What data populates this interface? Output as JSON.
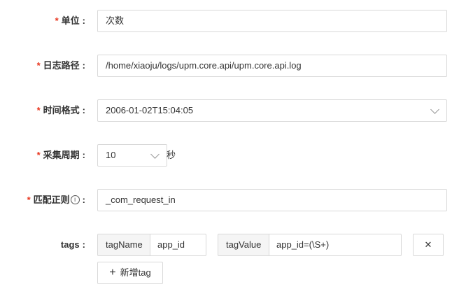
{
  "required_mark": "*",
  "colon": ":",
  "fields": {
    "unit": {
      "label": "单位",
      "value": "次数"
    },
    "log_path": {
      "label": "日志路径",
      "value": "/home/xiaoju/logs/upm.core.api/upm.core.api.log"
    },
    "time_format": {
      "label": "时间格式",
      "value": "2006-01-02T15:04:05"
    },
    "collect_period": {
      "label": "采集周期",
      "value": "10",
      "suffix": "秒"
    },
    "match_regex": {
      "label": "匹配正则",
      "info_icon": "i",
      "value": "_com_request_in"
    },
    "tags": {
      "label": "tags",
      "tag_name_addon": "tagName",
      "tag_name_value": "app_id",
      "tag_value_addon": "tagValue",
      "tag_value_value": "app_id=(\\S+)",
      "remove_glyph": "✕",
      "add_icon": "+",
      "add_label": "新增tag"
    }
  },
  "colors": {
    "required": "#e8361f",
    "border": "#d9d9d9",
    "addon_bg": "#f5f5f5",
    "text": "#333333"
  },
  "icons": [
    "chevron-down-icon",
    "info-circle-icon",
    "close-icon",
    "plus-icon"
  ]
}
